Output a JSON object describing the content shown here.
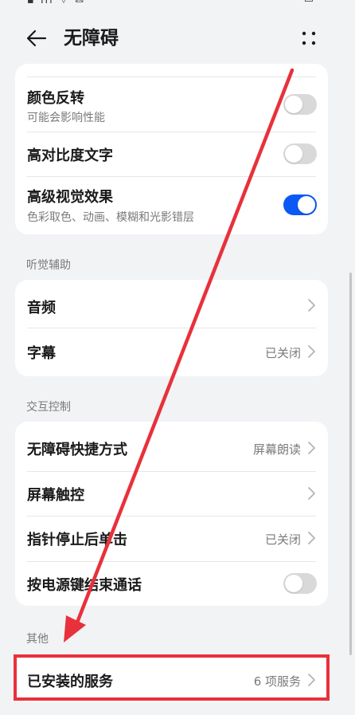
{
  "header": {
    "title": "无障碍",
    "back_icon": "arrow-left-icon",
    "more_icon": "more-dots-icon"
  },
  "vision_card": {
    "items": [
      {
        "label": "颜色反转",
        "sub": "可能会影响性能",
        "toggle": false
      },
      {
        "label": "高对比度文字",
        "toggle": false
      },
      {
        "label": "高级视觉效果",
        "sub": "色彩取色、动画、模糊和光影错层",
        "toggle": true
      }
    ]
  },
  "hearing_section": {
    "title": "听觉辅助",
    "items": [
      {
        "label": "音频",
        "value": ""
      },
      {
        "label": "字幕",
        "value": "已关闭"
      }
    ]
  },
  "interaction_section": {
    "title": "交互控制",
    "items": [
      {
        "label": "无障碍快捷方式",
        "value": "屏幕朗读"
      },
      {
        "label": "屏幕触控",
        "value": ""
      },
      {
        "label": "指针停止后单击",
        "value": "已关闭"
      },
      {
        "label": "按电源键结束通话",
        "toggle": false
      }
    ]
  },
  "other_section": {
    "title": "其他",
    "items": [
      {
        "label": "已安装的服务",
        "value": "6 项服务"
      }
    ]
  },
  "colors": {
    "accent": "#0a59f7",
    "annotation": "#e8313b",
    "background": "#f1f3f5"
  }
}
